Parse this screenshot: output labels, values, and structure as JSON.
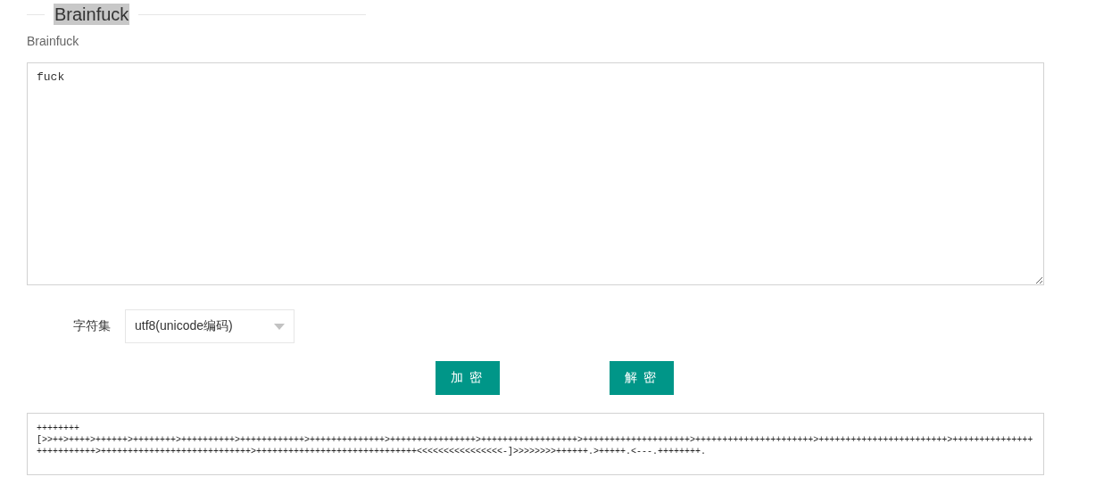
{
  "section": {
    "title": "Brainfuck",
    "label": "Brainfuck"
  },
  "input": {
    "value": "fuck"
  },
  "charset": {
    "label": "字符集",
    "value": "utf8(unicode编码)"
  },
  "buttons": [
    "加 密",
    "解 密"
  ],
  "output": {
    "value": "++++++++\n[>>++>++++>++++++>++++++++>++++++++++>++++++++++++>++++++++++++++>++++++++++++++++>++++++++++++++++++>++++++++++++++++++++>++++++++++++++++++++++>++++++++++++++++++++++++>++++++++++++++++++++++++++>++++++++++++++++++++++++++++>++++++++++++++++++++++++++++++<<<<<<<<<<<<<<<<-]>>>>>>>>++++++.>+++++.<---.++++++++."
  }
}
